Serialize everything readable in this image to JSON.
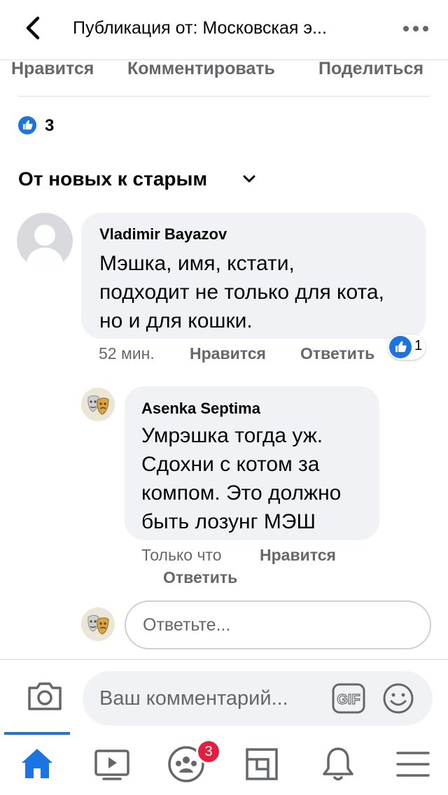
{
  "header": {
    "title": "Публикация от: Московская э...",
    "back_icon": "chevron-left-icon",
    "more_icon": "more-horizontal-icon"
  },
  "post_actions": {
    "like": "Нравится",
    "comment": "Комментировать",
    "share": "Поделиться"
  },
  "reactions": {
    "count": "3",
    "icon": "like-icon",
    "color": "#1b74e4"
  },
  "sort": {
    "label": "От новых к старым"
  },
  "comments": [
    {
      "author": "Vladimir Bayazov",
      "lines": [
        "Мэшка, имя, кстати,",
        "подходит не только для кота,",
        "но и для кошки."
      ],
      "time": "52 мин.",
      "like": "Нравится",
      "reply": "Ответить",
      "reaction_count": "1"
    },
    {
      "author": "Asenka Septima",
      "lines": [
        "Умрэшка тогда уж.",
        "Сдохни с котом за",
        "компом. Это должно",
        "быть лозунг МЭШ"
      ],
      "time": "Только что",
      "like": "Нравится",
      "reply": "Ответить"
    }
  ],
  "reply_input": {
    "placeholder": "Ответьте..."
  },
  "composer": {
    "placeholder": "Ваш комментарий...",
    "camera_icon": "camera-icon",
    "gif_icon": "gif-icon",
    "emoji_icon": "smiley-icon"
  },
  "tabbar": {
    "items": [
      "home-icon",
      "video-icon",
      "groups-icon",
      "pages-icon",
      "bell-icon",
      "menu-icon"
    ],
    "groups_badge": "3",
    "active_color": "#1b74e4",
    "badge_color": "#e41e3f"
  }
}
